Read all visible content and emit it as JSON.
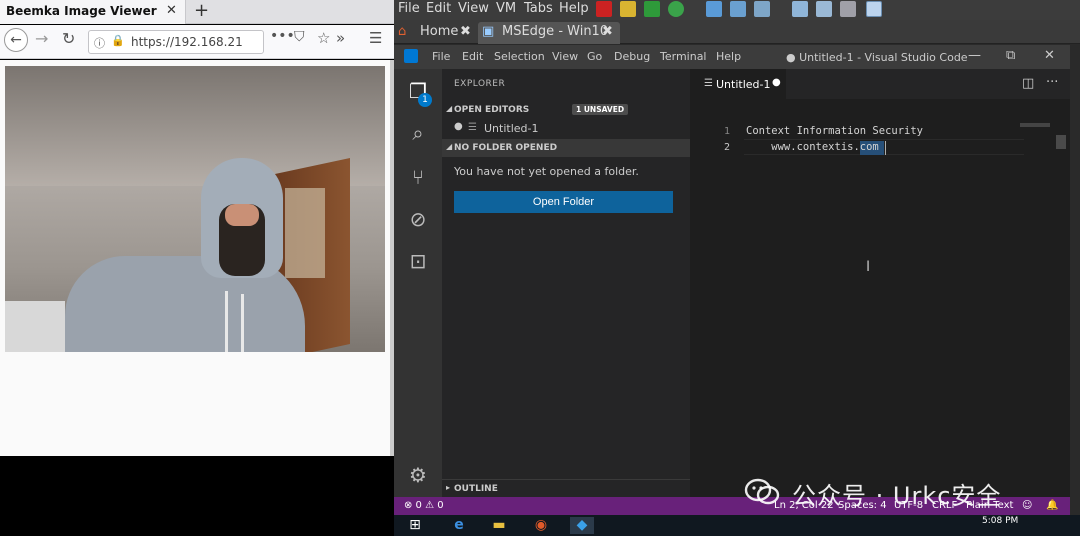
{
  "browser": {
    "tab_title": "Beemka Image Viewer",
    "tab_close": "✕",
    "new_tab": "+",
    "url": "https://192.168.21",
    "icons": {
      "back": "←",
      "forward": "→",
      "reload": "↻",
      "info": "ⓘ",
      "lock": "🔒",
      "more": "•••",
      "pocket": "⛉",
      "star": "☆",
      "overflow": "»",
      "menu": "☰"
    }
  },
  "vmware": {
    "menu": [
      "File",
      "Edit",
      "View",
      "VM",
      "Tabs",
      "Help"
    ],
    "tabs": [
      {
        "label": "Home",
        "close": "✖"
      },
      {
        "label": "MSEdge - Win10",
        "close": "✖"
      }
    ],
    "toolbar_colors": [
      "#d22",
      "#e8c23a",
      "#3a3",
      "#3a3",
      "#2e8bd8",
      "#5ea3e6",
      "#7fb0e0",
      "#9ab",
      "#aab",
      "#9bd"
    ]
  },
  "vscode": {
    "menu": [
      "File",
      "Edit",
      "Selection",
      "View",
      "Go",
      "Debug",
      "Terminal",
      "Help"
    ],
    "window_title": "● Untitled-1 - Visual Studio Code",
    "window_controls": [
      "—",
      "⧉",
      "✕"
    ],
    "explorer": {
      "title": "EXPLORER",
      "open_editors": "OPEN EDITORS",
      "unsaved_badge": "1 UNSAVED",
      "file_name": "Untitled-1",
      "no_folder": "NO FOLDER OPENED",
      "no_folder_msg": "You have not yet opened a folder.",
      "open_folder_button": "Open Folder",
      "outline": "OUTLINE"
    },
    "activity_badge": "1",
    "editor": {
      "tab_name": "Untitled-1",
      "tab_dirty": "●",
      "lines": [
        {
          "n": "1",
          "text": "Context Information Security"
        },
        {
          "n": "2",
          "text": "    www.contextis.com"
        }
      ]
    },
    "status": {
      "problems": "⊗ 0 ⚠ 0",
      "position": "Ln 2, Col 22",
      "spaces": "Spaces: 4",
      "encoding": "UTF-8",
      "eol": "CRLF",
      "language": "Plain Text",
      "feedback": "☺",
      "bell": "🔔"
    }
  },
  "taskbar": {
    "clock": "5:08 PM"
  },
  "watermark": "公众号 · Urkc安全"
}
